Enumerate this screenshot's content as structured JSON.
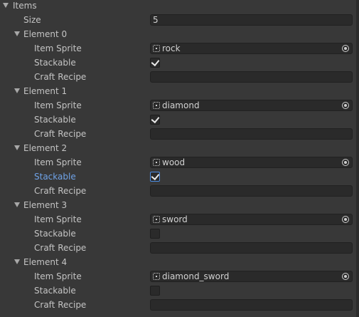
{
  "items": {
    "label": "Items",
    "size_label": "Size",
    "size_value": "5",
    "elements": [
      {
        "label": "Element 0",
        "sprite_label": "Item Sprite",
        "sprite_value": "rock",
        "stackable_label": "Stackable",
        "stackable_checked": true,
        "recipe_label": "Craft Recipe",
        "recipe_value": ""
      },
      {
        "label": "Element 1",
        "sprite_label": "Item Sprite",
        "sprite_value": "diamond",
        "stackable_label": "Stackable",
        "stackable_checked": true,
        "recipe_label": "Craft Recipe",
        "recipe_value": ""
      },
      {
        "label": "Element 2",
        "sprite_label": "Item Sprite",
        "sprite_value": "wood",
        "stackable_label": "Stackable",
        "stackable_checked": true,
        "recipe_label": "Craft Recipe",
        "recipe_value": ""
      },
      {
        "label": "Element 3",
        "sprite_label": "Item Sprite",
        "sprite_value": "sword",
        "stackable_label": "Stackable",
        "stackable_checked": false,
        "recipe_label": "Craft Recipe",
        "recipe_value": ""
      },
      {
        "label": "Element 4",
        "sprite_label": "Item Sprite",
        "sprite_value": "diamond_sword",
        "stackable_label": "Stackable",
        "stackable_checked": false,
        "recipe_label": "Craft Recipe",
        "recipe_value": ""
      }
    ]
  },
  "colors": {
    "background": "#383838",
    "field_background": "#2a2a2a",
    "text": "#c4c4c4",
    "focused_label": "#6fa3e8",
    "focus_outline": "#4b8ee6"
  },
  "icons": {
    "foldout": "triangle-down-icon",
    "sprite": "sprite-icon",
    "object_picker": "object-picker-icon",
    "check": "checkmark-icon"
  }
}
